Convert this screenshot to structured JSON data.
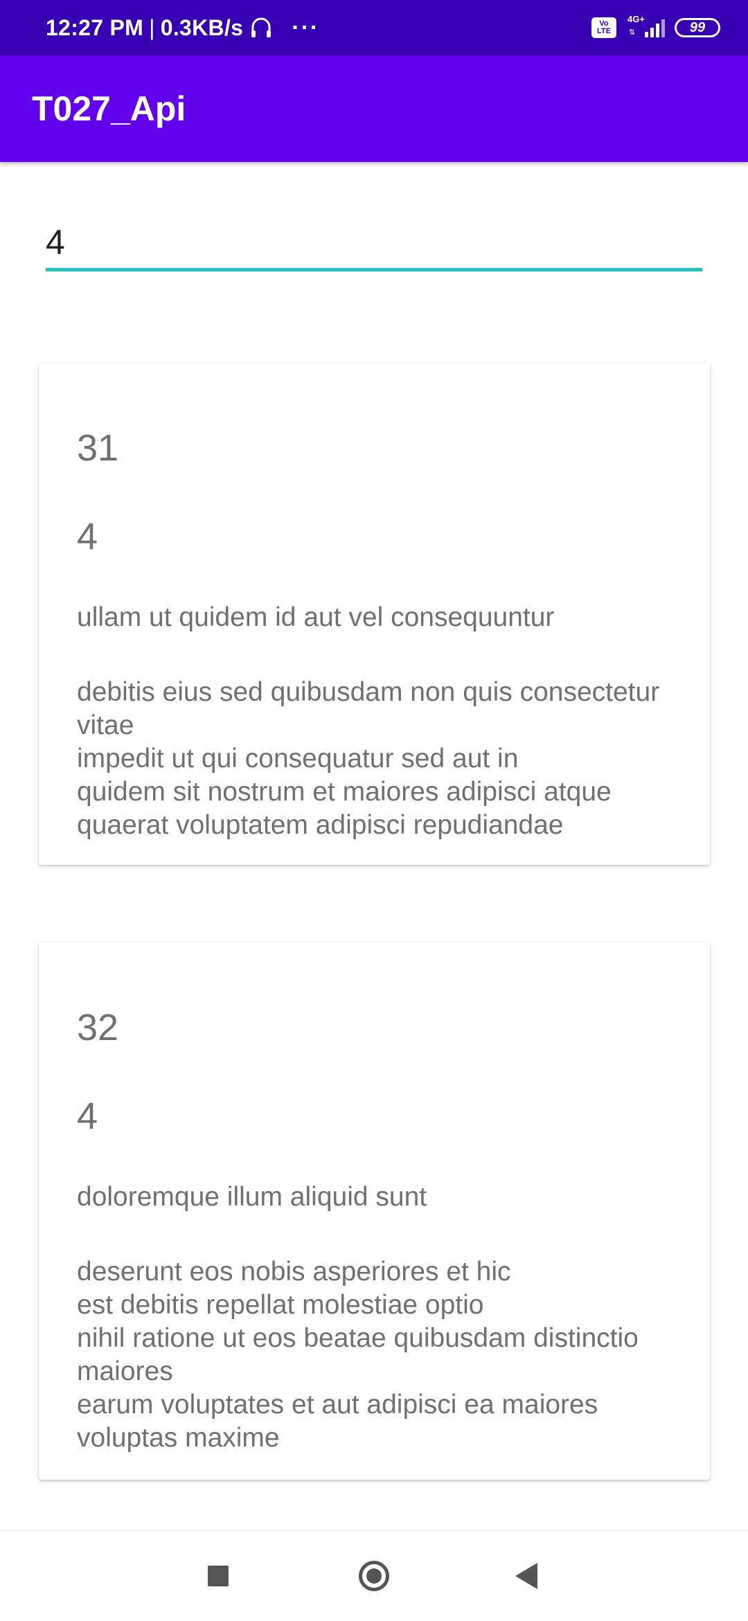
{
  "status_bar": {
    "time": "12:27 PM",
    "separator": "|",
    "net_speed": "0.3KB/s",
    "more": "···",
    "volte": "Vo\nLTE",
    "network": "4G+",
    "data_arrows": "⇅",
    "battery": "99",
    "icons": [
      "headphone-icon",
      "more-icon",
      "volte-icon",
      "signal-icon",
      "battery-icon"
    ]
  },
  "app_bar": {
    "title": "T027_Api"
  },
  "search": {
    "value": "4"
  },
  "posts": [
    {
      "id": "31",
      "user_id": "4",
      "title": "ullam ut quidem id aut vel consequuntur",
      "body": "debitis eius sed quibusdam non quis consectetur vitae\nimpedit ut qui consequatur sed aut in\nquidem sit nostrum et maiores adipisci atque\nquaerat voluptatem adipisci repudiandae"
    },
    {
      "id": "32",
      "user_id": "4",
      "title": "doloremque illum aliquid sunt",
      "body": "deserunt eos nobis asperiores et hic\nest debitis repellat molestiae optio\nnihil ratione ut eos beatae quibusdam distinctio maiores\nearum voluptates et aut adipisci ea maiores voluptas maxime"
    }
  ],
  "nav_bar": {
    "icons": [
      "recents-icon",
      "home-icon",
      "back-icon"
    ]
  },
  "colors": {
    "status_bar": "#3700b3",
    "app_bar": "#6200ee",
    "input_underline": "#1ec8c0",
    "card_text": "#707070"
  }
}
